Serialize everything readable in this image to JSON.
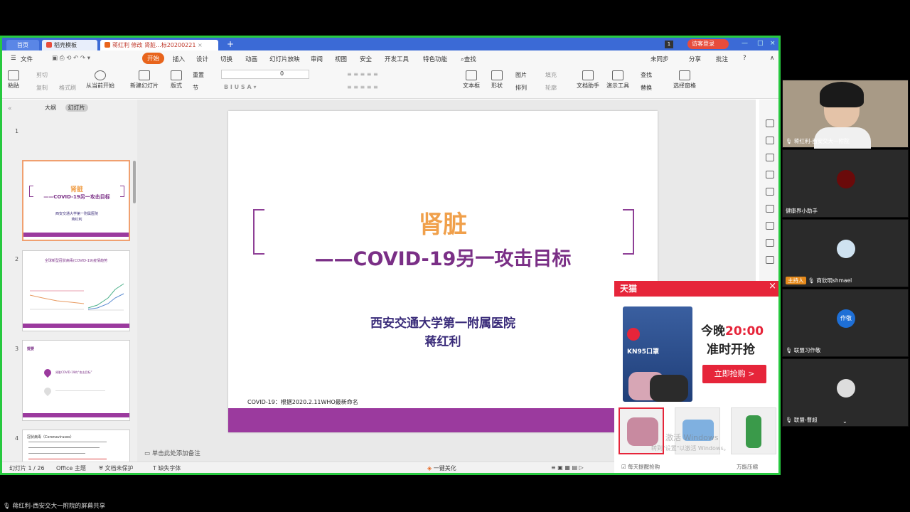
{
  "wps": {
    "tabs": {
      "home": "首页",
      "template": "稻壳模板",
      "doc": "蒋红利 修改 肾脏...标20200221"
    },
    "tab_count": "1",
    "visitor_login": "访客登录",
    "menu": {
      "file": "文件",
      "start": "开始",
      "insert": "插入",
      "design": "设计",
      "switch": "切换",
      "animation": "动画",
      "slideshow": "幻灯片放映",
      "review": "审阅",
      "view": "视图",
      "security": "安全",
      "devtools": "开发工具",
      "features": "特色功能",
      "search": "查找",
      "unsynced": "未同步",
      "share": "分享",
      "annotate": "批注"
    },
    "ribbon": {
      "paste": "粘贴",
      "cut": "剪切",
      "copy": "复制",
      "format_painter": "格式刷",
      "from_current": "从当前开始",
      "new_slide": "新建幻灯片",
      "layout": "版式",
      "section": "节",
      "reset": "重置",
      "font_size": "0",
      "textbox": "文本框",
      "shape": "形状",
      "picture": "图片",
      "fill": "填充",
      "arrange": "排列",
      "outline": "轮廓",
      "doc_assistant": "文档助手",
      "present_tools": "演示工具",
      "find": "查找",
      "replace": "替换",
      "select_pane": "选择窗格"
    },
    "left": {
      "outline_tab": "大纲",
      "slides_tab": "幻灯片",
      "slide_numbers": [
        "1",
        "2",
        "3",
        "4"
      ]
    },
    "thumb1": {
      "title": "肾脏",
      "sub": "——COVID-19另一攻击目标",
      "org": "西安交通大学第一附属医院",
      "name": "蒋红利"
    },
    "thumb2": {
      "title": "全球新型冠状病毒(COVID-19)疫情趋势"
    },
    "thumb3": {
      "title": "提要",
      "item": "肾脏COVID-19的“攻击目标”"
    },
    "thumb4": {
      "title": "冠状病毒（Coronaviruses）"
    },
    "slide": {
      "title": "肾脏",
      "subtitle": "——COVID-19另一攻击目标",
      "org": "西安交通大学第一附属医院",
      "author": "蒋红利",
      "footnote": "COVID-19：根据2020.2.11WHO最新命名"
    },
    "notes_placeholder": "单击此处添加备注",
    "status": {
      "slide_index": "幻灯片 1 / 26",
      "theme": "Office 主题",
      "protected": "文档未保护",
      "missing_font": "缺失字体",
      "beautify": "一键美化"
    }
  },
  "ad": {
    "brand": "天猫",
    "product_label": "KN95口罩",
    "tonight": "今晚",
    "time": "20:00",
    "start": "准时开抢",
    "buy_button": "立即抢购 >",
    "daily_remind": "每天提醒抢购",
    "watermark": "激活 Windows",
    "watermark_sub": "转到\"设置\"以激活 Windows。",
    "store": "万能压缩"
  },
  "participants": [
    {
      "name": "蒋红利-西安交大一附院",
      "type": "video"
    },
    {
      "name": "健康界小助手",
      "type": "avatar"
    },
    {
      "name": "商欣明shmael",
      "host_label": "主持人",
      "type": "avatar"
    },
    {
      "name": "联盟习作敬",
      "avatar_text": "作敬",
      "type": "avatar"
    },
    {
      "name": "联盟-曹超",
      "type": "avatar"
    }
  ],
  "share_caption": "蒋红利-西安交大一附院的屏幕共享",
  "colors": {
    "accent": "#e8641c",
    "purple": "#9b3a9e",
    "orange_title": "#f0a04b",
    "tmall_red": "#e6253a",
    "share_border": "#27c93f"
  }
}
